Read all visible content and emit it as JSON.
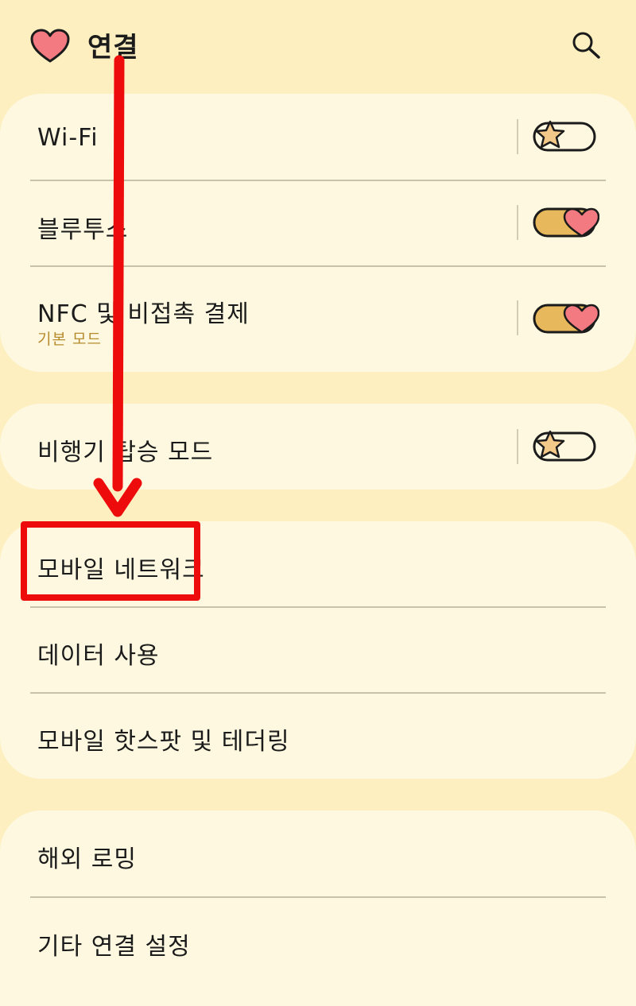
{
  "header": {
    "title": "연결",
    "logo_icon": "heart-icon",
    "search_icon": "search-icon"
  },
  "cards": [
    {
      "rows": [
        {
          "label": "Wi-Fi",
          "toggle": "off"
        },
        {
          "label": "블루투스",
          "toggle": "on"
        },
        {
          "label": "NFC 및 비접촉 결제",
          "sublabel": "기본 모드",
          "toggle": "on"
        }
      ]
    },
    {
      "rows": [
        {
          "label": "비행기 탑승 모드",
          "toggle": "off"
        }
      ]
    },
    {
      "rows": [
        {
          "label": "모바일 네트워크"
        },
        {
          "label": "데이터 사용"
        },
        {
          "label": "모바일 핫스팟 및 테더링"
        }
      ]
    },
    {
      "rows": [
        {
          "label": "해외 로밍"
        },
        {
          "label": "기타 연결 설정"
        }
      ]
    }
  ],
  "annotation": {
    "arrow_color": "#ee0b0b",
    "highlight_color": "#ee0b0b",
    "target": "모바일 네트워크"
  },
  "colors": {
    "background": "#fdefc0",
    "card": "#fdf8df",
    "toggle_on": "#e8b95c",
    "toggle_heart": "#f47a82",
    "toggle_star": "#f3c98a",
    "sublabel": "#b88a2e"
  }
}
